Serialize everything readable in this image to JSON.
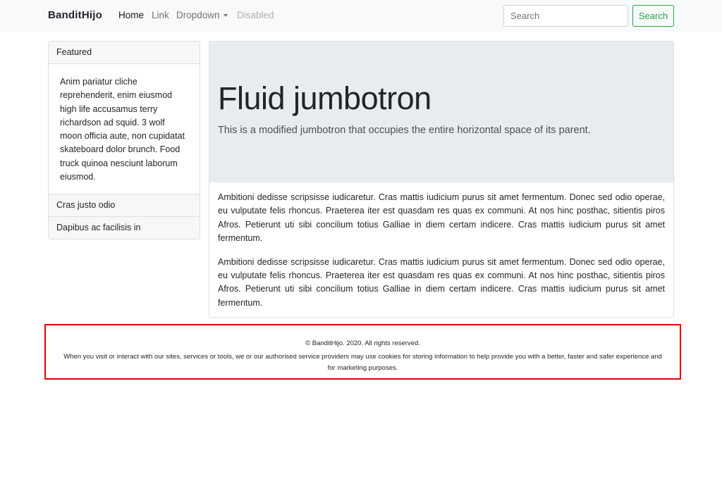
{
  "navbar": {
    "brand": "BanditHijo",
    "links": {
      "home": "Home",
      "link": "Link",
      "dropdown": "Dropdown",
      "disabled": "Disabled"
    },
    "search": {
      "placeholder": "Search",
      "button_label": "Search"
    }
  },
  "sidebar": {
    "header": "Featured",
    "body_text": "Anim pariatur cliche reprehenderit, enim eiusmod high life accusamus terry richardson ad squid. 3 wolf moon officia aute, non cupidatat skateboard dolor brunch. Food truck quinoa nesciunt laborum eiusmod.",
    "items": [
      {
        "label": "Cras justo odio"
      },
      {
        "label": "Dapibus ac facilisis in"
      }
    ]
  },
  "jumbotron": {
    "title": "Fluid jumbotron",
    "lead": "This is a modified jumbotron that occupies the entire horizontal space of its parent."
  },
  "main": {
    "paragraphs": [
      "Ambitioni dedisse scripsisse iudicaretur. Cras mattis iudicium purus sit amet fermentum. Donec sed odio operae, eu vulputate felis rhoncus. Praeterea iter est quasdam res quas ex communi. At nos hinc posthac, sitientis piros Afros. Petierunt uti sibi concilium totius Galliae in diem certam indicere. Cras mattis iudicium purus sit amet fermentum.",
      "Ambitioni dedisse scripsisse iudicaretur. Cras mattis iudicium purus sit amet fermentum. Donec sed odio operae, eu vulputate felis rhoncus. Praeterea iter est quasdam res quas ex communi. At nos hinc posthac, sitientis piros Afros. Petierunt uti sibi concilium totius Galliae in diem certam indicere. Cras mattis iudicium purus sit amet fermentum."
    ]
  },
  "footer": {
    "copyright": "© BanditHijo. 2020. All rights reserved.",
    "notice": "When you visit or interact with our sites, services or tools, we or our authorised service providers may use cookies for storing information to help provide you with a better, faster and safer experience and for marketing purposes."
  },
  "colors": {
    "navbar_bg": "#f8f9fa",
    "success": "#28a745",
    "jumbotron_bg": "#e9ecef",
    "highlight_border": "#e60000"
  }
}
